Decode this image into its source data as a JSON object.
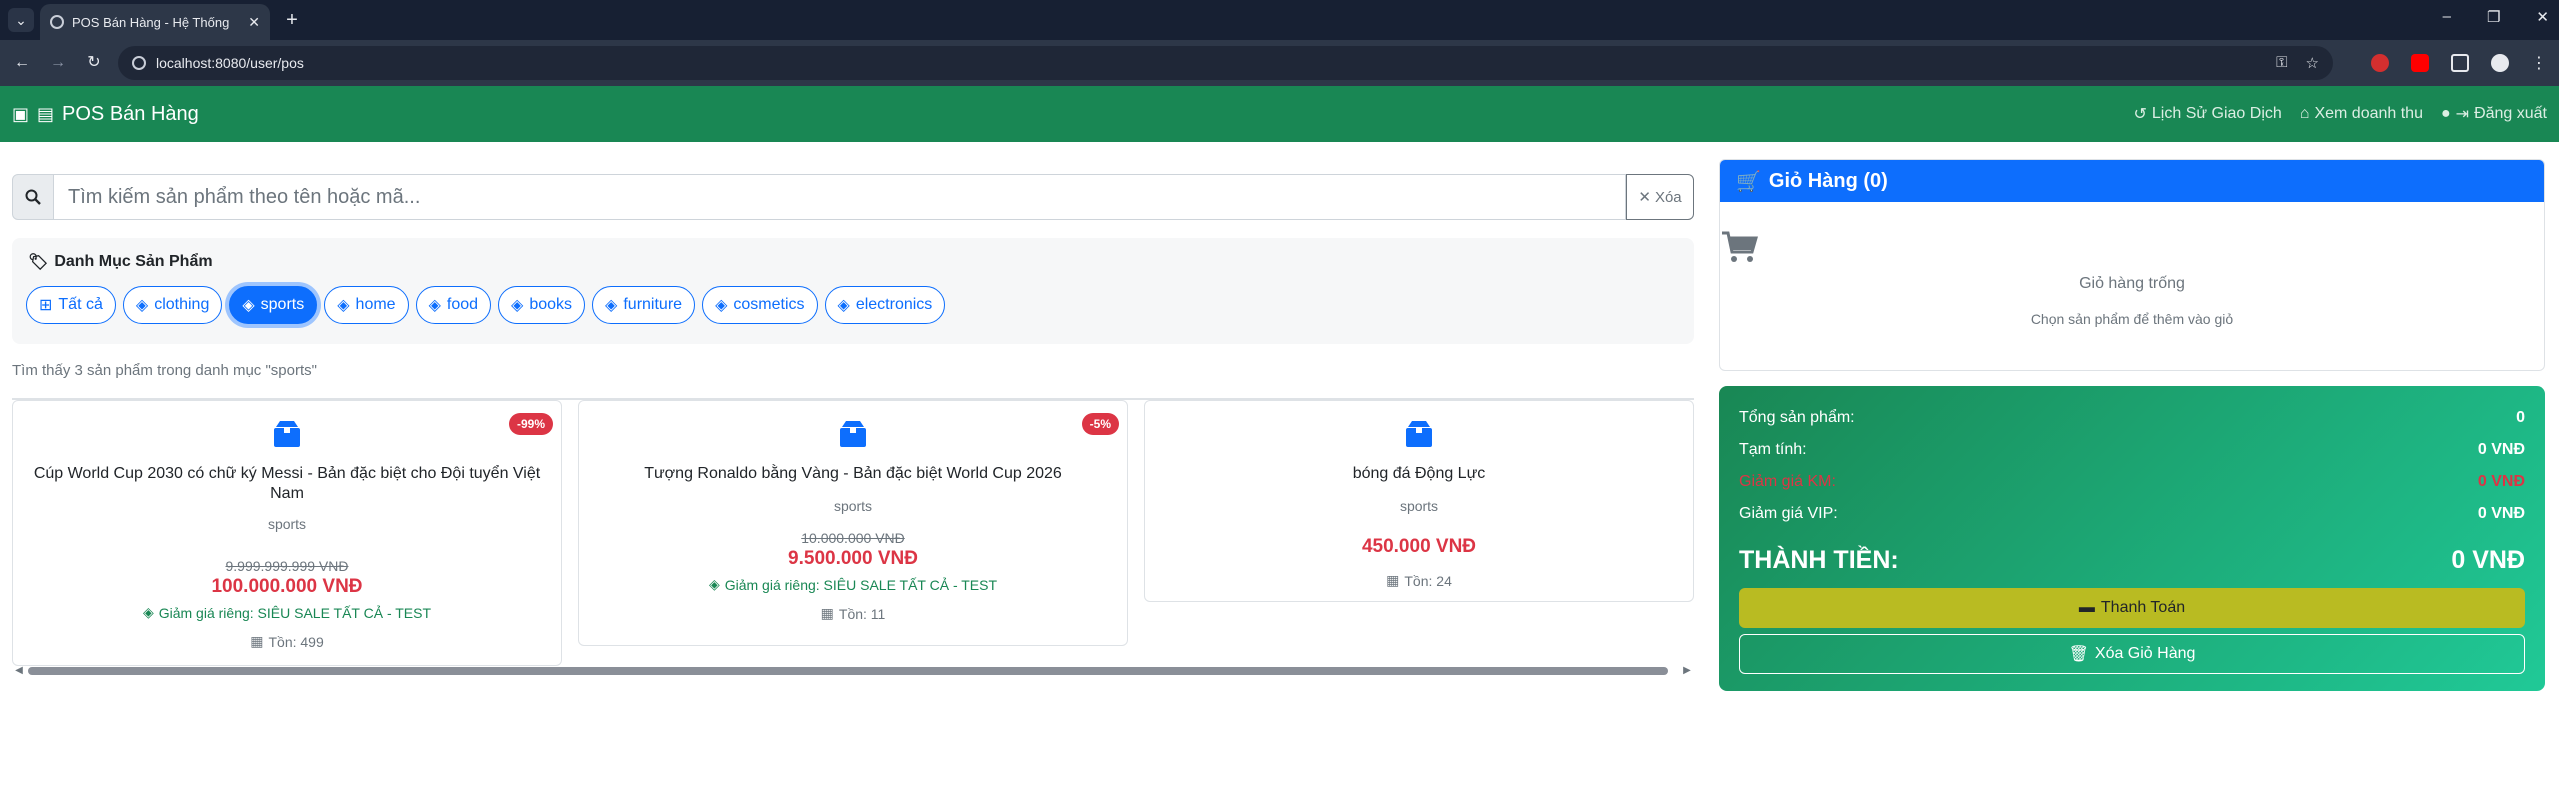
{
  "browser": {
    "tab_title": "POS Bán Hàng - Hệ Thống",
    "url": "localhost:8080/user/pos"
  },
  "navbar": {
    "brand": "POS Bán Hàng",
    "links": {
      "history": "Lịch Sử Giao Dịch",
      "revenue": "Xem doanh thu",
      "logout": "Đăng xuất"
    }
  },
  "search": {
    "placeholder": "Tìm kiếm sản phẩm theo tên hoặc mã...",
    "clear_label": "Xóa"
  },
  "categories": {
    "title": "Danh Mục Sản Phẩm",
    "items": [
      "Tất cả",
      "clothing",
      "sports",
      "home",
      "food",
      "books",
      "furniture",
      "cosmetics",
      "electronics"
    ],
    "active": "sports"
  },
  "results_text": "Tìm thấy 3 sản phẩm trong danh mục \"sports\"",
  "products": [
    {
      "name": "Cúp World Cup 2030 có chữ ký Messi - Bản đặc biệt cho Đội tuyển Việt Nam",
      "category": "sports",
      "discount_badge": "-99%",
      "old_price": "9.999.999.999 VNĐ",
      "price": "100.000.000 VNĐ",
      "promo": "Giảm giá riêng: SIÊU SALE TẤT CẢ - TEST",
      "stock": "Tồn: 499"
    },
    {
      "name": "Tượng Ronaldo bằng Vàng - Bản đặc biệt World Cup 2026",
      "category": "sports",
      "discount_badge": "-5%",
      "old_price": "10.000.000 VNĐ",
      "price": "9.500.000 VNĐ",
      "promo": "Giảm giá riêng: SIÊU SALE TẤT CẢ - TEST",
      "stock": "Tồn: 11"
    },
    {
      "name": "bóng đá Động Lực",
      "category": "sports",
      "price": "450.000 VNĐ",
      "stock": "Tồn: 24"
    }
  ],
  "cart": {
    "title": "Giỏ Hàng (0)",
    "empty_text": "Giỏ hàng trống",
    "hint": "Chọn sản phẩm để thêm vào giỏ"
  },
  "summary": {
    "total_items_label": "Tổng sản phẩm:",
    "total_items_value": "0",
    "subtotal_label": "Tạm tính:",
    "subtotal_value": "0 VNĐ",
    "promo_label": "Giảm giá KM:",
    "promo_value": "0 VNĐ",
    "vip_label": "Giảm giá VIP:",
    "vip_value": "0 VNĐ",
    "grand_label": "THÀNH TIỀN:",
    "grand_value": "0 VNĐ",
    "pay_label": "Thanh Toán",
    "clear_label": "Xóa Giỏ Hàng"
  },
  "colors": {
    "navbar": "#198754",
    "primary": "#0d6efd",
    "danger": "#dc3545",
    "pay_button": "#b9bb22"
  }
}
